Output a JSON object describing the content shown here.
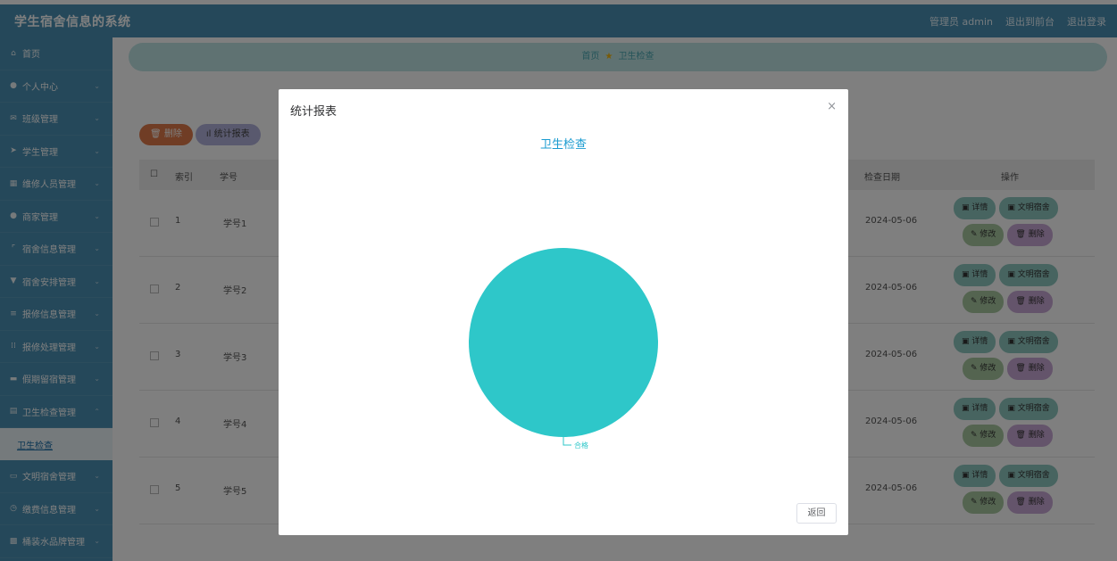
{
  "header": {
    "title": "学生宿舍信息的系统",
    "admin": "管理员 admin",
    "to_front": "退出到前台",
    "logout": "退出登录"
  },
  "sidebar": {
    "items": [
      {
        "label": "首页",
        "icon": "home-icon"
      },
      {
        "label": "个人中心",
        "icon": "user-icon"
      },
      {
        "label": "班级管理",
        "icon": "mail-icon"
      },
      {
        "label": "学生管理",
        "icon": "send-icon"
      },
      {
        "label": "维修人员管理",
        "icon": "grid-icon"
      },
      {
        "label": "商家管理",
        "icon": "location-icon"
      },
      {
        "label": "宿舍信息管理",
        "icon": "crop-icon"
      },
      {
        "label": "宿舍安排管理",
        "icon": "gift-icon"
      },
      {
        "label": "报修信息管理",
        "icon": "list-icon"
      },
      {
        "label": "报修处理管理",
        "icon": "apps-icon"
      },
      {
        "label": "假期留宿管理",
        "icon": "monitor-icon"
      },
      {
        "label": "卫生检查管理",
        "icon": "doc-icon"
      }
    ],
    "sub_item": "卫生检查",
    "items_after": [
      {
        "label": "文明宿舍管理",
        "icon": "chat-icon"
      },
      {
        "label": "缴费信息管理",
        "icon": "clock-icon"
      },
      {
        "label": "桶装水品牌管理",
        "icon": "box-icon"
      }
    ]
  },
  "breadcrumb": {
    "home": "首页",
    "current": "卫生检查"
  },
  "toolbar": {
    "delete_label": "删除",
    "stats_label": "统计报表"
  },
  "table": {
    "headers": {
      "index": "索引",
      "student_no": "学号",
      "check_date": "检查日期",
      "actions": "操作"
    },
    "rows": [
      {
        "index": "1",
        "student_no": "学号1",
        "date": "2024-05-06"
      },
      {
        "index": "2",
        "student_no": "学号2",
        "date": "2024-05-06"
      },
      {
        "index": "3",
        "student_no": "学号3",
        "date": "2024-05-06"
      },
      {
        "index": "4",
        "student_no": "学号4",
        "date": "2024-05-06"
      },
      {
        "index": "5",
        "student_no": "学号5",
        "date": "2024-05-06"
      }
    ],
    "actions": {
      "detail": "详情",
      "civil": "文明宿舍",
      "edit": "修改",
      "delete": "删除"
    }
  },
  "dialog": {
    "title": "统计报表",
    "close": "×",
    "back": "返回"
  },
  "chart_data": {
    "type": "pie",
    "title": "卫生检查",
    "slices": [
      {
        "label": "合格",
        "value": 1,
        "color": "#2ec7c9"
      }
    ]
  }
}
